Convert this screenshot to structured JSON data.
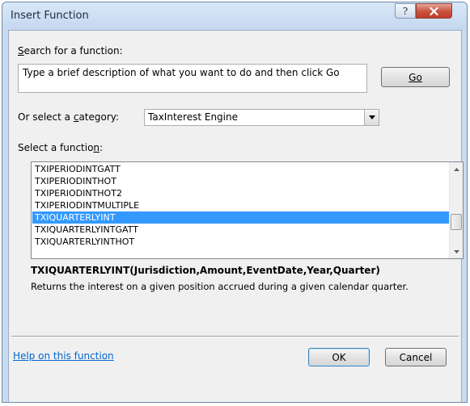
{
  "window": {
    "title": "Insert Function",
    "help_button": "?",
    "close_button": "x"
  },
  "search": {
    "label_pre": "",
    "label_accel": "S",
    "label_post": "earch for a function:",
    "value": "Type a brief description of what you want to do and then click Go",
    "go_label": "Go"
  },
  "category": {
    "label_pre": "Or select a ",
    "label_accel": "c",
    "label_post": "ategory:",
    "selected": "TaxInterest Engine"
  },
  "functions": {
    "label_pre": "Select a functio",
    "label_accel": "n",
    "label_post": ":",
    "items": [
      "TXIPERIODINTGATT",
      "TXIPERIODINTHOT",
      "TXIPERIODINTHOT2",
      "TXIPERIODINTMULTIPLE",
      "TXIQUARTERLYINT",
      "TXIQUARTERLYINTGATT",
      "TXIQUARTERLYINTHOT"
    ],
    "selected_index": 4,
    "scroll_position": 0.72
  },
  "details": {
    "syntax": "TXIQUARTERLYINT(Jurisdiction,Amount,EventDate,Year,Quarter)",
    "description": "Returns the interest on a given position accrued during a given calendar quarter."
  },
  "footer": {
    "help_link": "Help on this function",
    "ok_label": "OK",
    "cancel_label": "Cancel"
  },
  "colors": {
    "selection": "#3399ff",
    "link": "#0066cc",
    "close_button": "#c9503c",
    "frame": "#c9dbef"
  }
}
